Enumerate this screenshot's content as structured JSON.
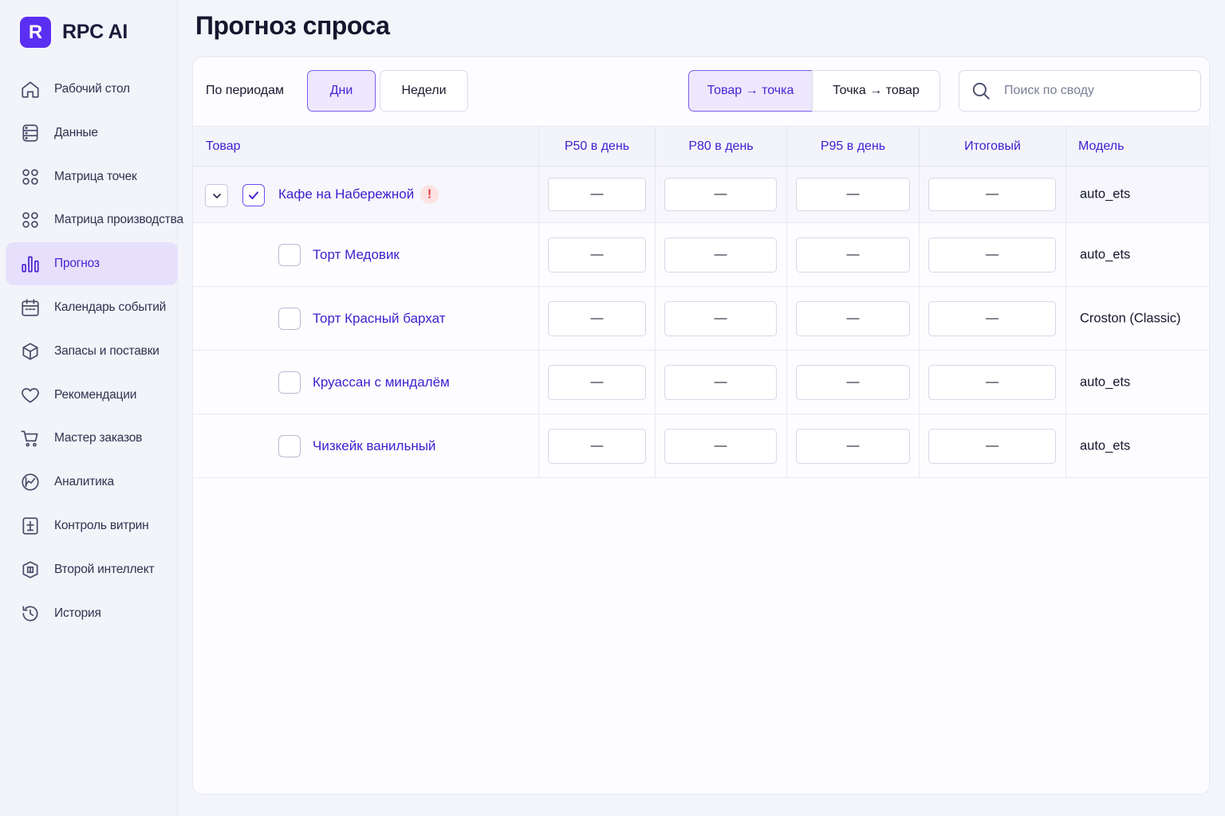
{
  "brand": {
    "logo_letter": "R",
    "name": "RPC AI",
    "accent": "#5b2ff2"
  },
  "page": {
    "title": "Прогноз спроса"
  },
  "sidebar": {
    "items": [
      {
        "label": "Рабочий стол",
        "icon": "home-icon",
        "active": false
      },
      {
        "label": "Данные",
        "icon": "database-icon",
        "active": false
      },
      {
        "label": "Матрица точек",
        "icon": "grid-icon",
        "active": false
      },
      {
        "label": "Матрица производства",
        "icon": "grid-icon",
        "active": false
      },
      {
        "label": "Прогноз",
        "icon": "bar-chart-icon",
        "active": true
      },
      {
        "label": "Календарь событий",
        "icon": "calendar-icon",
        "active": false
      },
      {
        "label": "Запасы и поставки",
        "icon": "box-icon",
        "active": false
      },
      {
        "label": "Рекомендации",
        "icon": "heart-icon",
        "active": false
      },
      {
        "label": "Мастер заказов",
        "icon": "cart-icon",
        "active": false
      },
      {
        "label": "Аналитика",
        "icon": "analytics-icon",
        "active": false
      },
      {
        "label": "Контроль витрин",
        "icon": "showcase-icon",
        "active": false
      },
      {
        "label": "Второй интеллект",
        "icon": "brain-icon",
        "active": false
      },
      {
        "label": "История",
        "icon": "history-icon",
        "active": false
      }
    ]
  },
  "toolbar": {
    "period_label": "По периодам",
    "days": "Дни",
    "weeks": "Недели",
    "active_period": "days",
    "product_to_point": "Товар → точка",
    "point_to_product": "Точка → товар",
    "active_view": "product_to_point",
    "search_placeholder": "Поиск по своду"
  },
  "table": {
    "headers": {
      "product": "Товар",
      "p50": "P50 в день",
      "p80": "P80 в день",
      "p95": "P95 в день",
      "final": "Итоговый",
      "model": "Модель"
    },
    "group": {
      "name": "Кафе на Набережной",
      "expanded": true,
      "checked": true,
      "warning": "!",
      "p50": "—",
      "p80": "—",
      "p95": "—",
      "final": "—",
      "model": "auto_ets"
    },
    "rows": [
      {
        "name": "Торт Медовик",
        "checked": false,
        "p50": "—",
        "p80": "—",
        "p95": "—",
        "final": "—",
        "model": "auto_ets"
      },
      {
        "name": "Торт Красный бархат",
        "checked": false,
        "p50": "—",
        "p80": "—",
        "p95": "—",
        "final": "—",
        "model": "Croston (Classic)"
      },
      {
        "name": "Круассан с миндалём",
        "checked": false,
        "p50": "—",
        "p80": "—",
        "p95": "—",
        "final": "—",
        "model": "auto_ets"
      },
      {
        "name": "Чизкейк ванильный",
        "checked": false,
        "p50": "—",
        "p80": "—",
        "p95": "—",
        "final": "—",
        "model": "auto_ets"
      }
    ]
  }
}
